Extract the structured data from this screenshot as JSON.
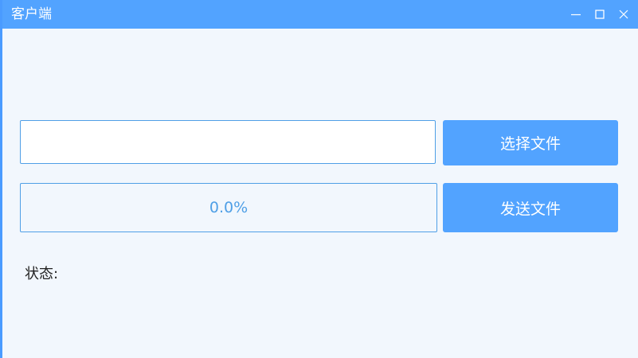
{
  "window": {
    "title": "客户端",
    "controls": {
      "minimize_icon": "minimize-icon",
      "maximize_icon": "maximize-icon",
      "close_icon": "close-icon"
    }
  },
  "colors": {
    "accent": "#52a3ff",
    "border": "#4f9fe6",
    "background": "#f2f7fd"
  },
  "file_input": {
    "value": "",
    "placeholder": ""
  },
  "buttons": {
    "select_file": "选择文件",
    "send_file": "发送文件"
  },
  "progress": {
    "value": 0.0,
    "text": "0.0%"
  },
  "status": {
    "label": "状态:"
  }
}
